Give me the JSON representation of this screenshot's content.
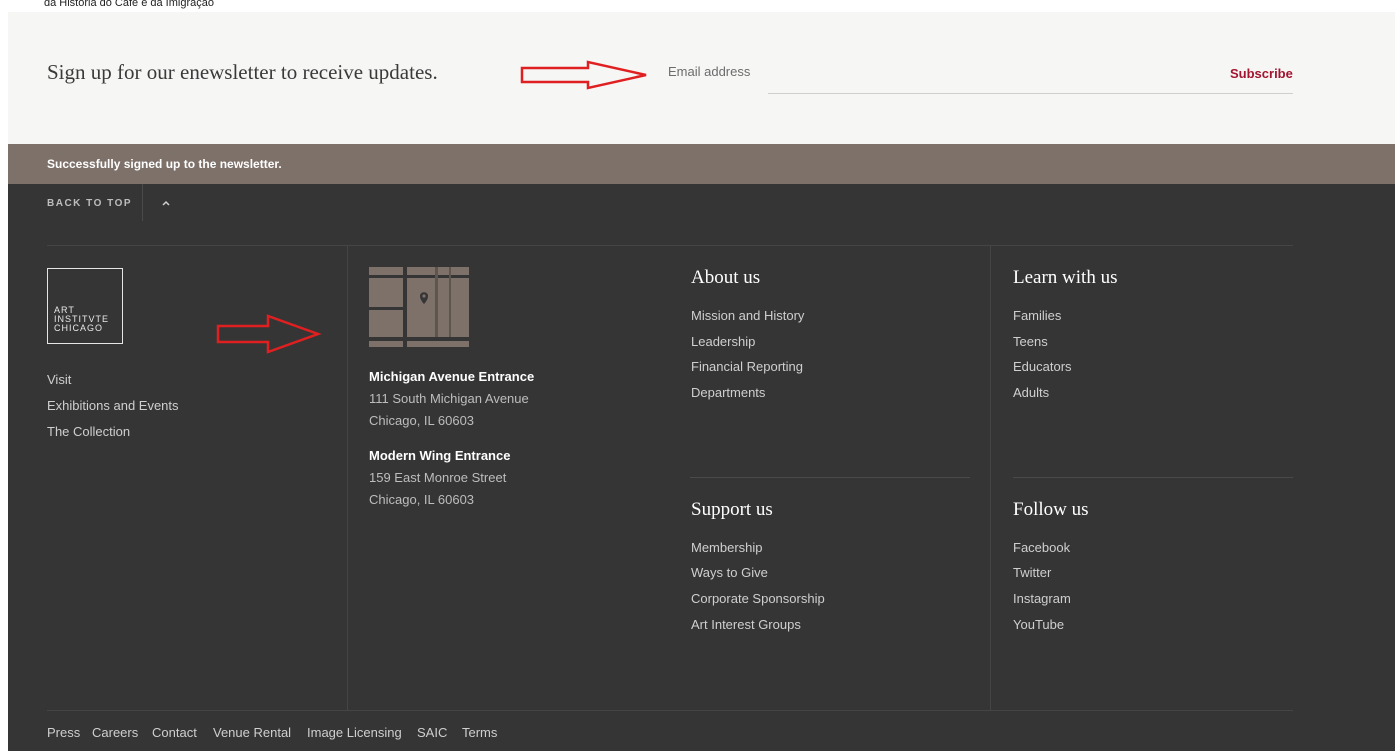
{
  "page": {
    "top_caption": "da História do Café e da Imigração"
  },
  "newsletter": {
    "prompt": "Sign up for our enewsletter to receive updates.",
    "email_placeholder": "Email address",
    "subscribe_label": "Subscribe"
  },
  "status": {
    "message": "Successfully signed up to the newsletter."
  },
  "footer": {
    "back_to_top": "BACK TO TOP",
    "logo": {
      "line1": "ART",
      "line2": "INSTITVTE",
      "line3": "CHICAGO"
    },
    "main_links": [
      "Visit",
      "Exhibitions and Events",
      "The Collection"
    ],
    "addresses": [
      {
        "title": "Michigan Avenue Entrance",
        "street": "111 South Michigan Avenue",
        "city": "Chicago, IL 60603"
      },
      {
        "title": "Modern Wing Entrance",
        "street": "159 East Monroe Street",
        "city": "Chicago, IL 60603"
      }
    ],
    "about": {
      "heading": "About us",
      "links": [
        "Mission and History",
        "Leadership",
        "Financial Reporting",
        "Departments"
      ]
    },
    "learn": {
      "heading": "Learn with us",
      "links": [
        "Families",
        "Teens",
        "Educators",
        "Adults"
      ]
    },
    "support": {
      "heading": "Support us",
      "links": [
        "Membership",
        "Ways to Give",
        "Corporate Sponsorship",
        "Art Interest Groups"
      ]
    },
    "follow": {
      "heading": "Follow us",
      "links": [
        "Facebook",
        "Twitter",
        "Instagram",
        "YouTube"
      ]
    },
    "legal_links": [
      "Press",
      "Careers",
      "Contact",
      "Venue Rental",
      "Image Licensing",
      "SAIC",
      "Terms"
    ]
  },
  "colors": {
    "accent": "#a3152f",
    "footer_bg": "#353535",
    "status_bg": "#7d716a",
    "newsletter_bg": "#f6f6f5",
    "annotation_arrow": "#e02020"
  }
}
